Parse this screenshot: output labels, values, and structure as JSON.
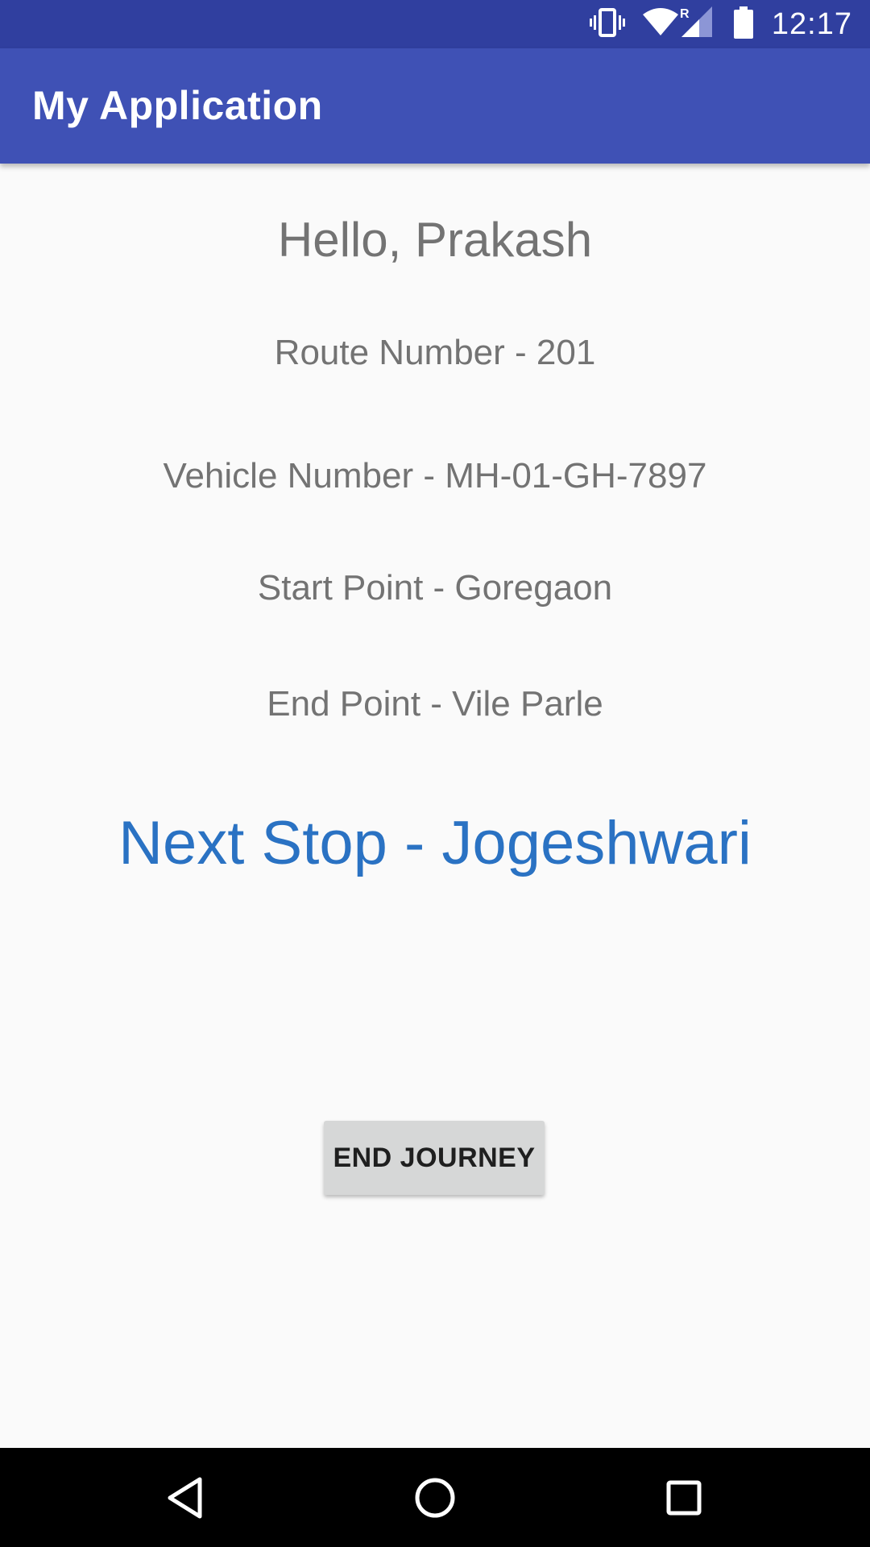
{
  "status_bar": {
    "time": "12:17",
    "icons": [
      "vibrate-icon",
      "wifi-icon",
      "signal-roaming-icon",
      "battery-icon"
    ],
    "roaming_indicator": "R",
    "background_color": "#303f9f"
  },
  "app_bar": {
    "title": "My Application",
    "background_color": "#3f51b5"
  },
  "main": {
    "greeting": "Hello, Prakash",
    "route_number": "Route Number - 201",
    "vehicle_number": "Vehicle Number - MH-01-GH-7897",
    "start_point": "Start Point - Goregaon",
    "end_point": "End Point - Vile Parle",
    "next_stop": "Next Stop - Jogeshwari",
    "next_stop_color": "#2a72c3",
    "end_journey_label": "END JOURNEY"
  },
  "nav_bar": {
    "buttons": [
      "back-icon",
      "home-icon",
      "recents-icon"
    ]
  }
}
